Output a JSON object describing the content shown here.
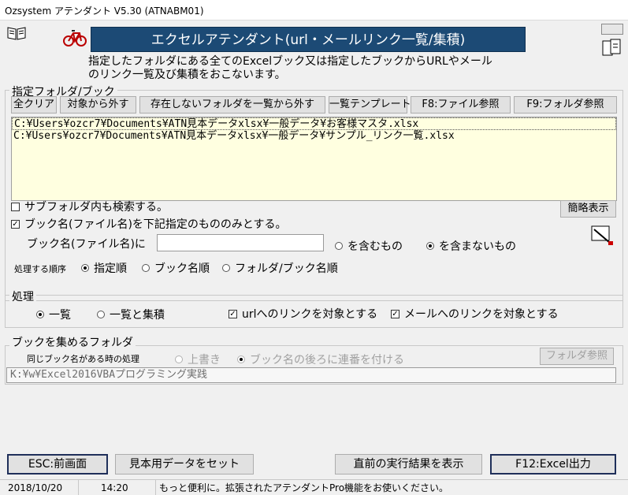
{
  "window": {
    "title": "Ozsystem アテンダント V5.30 (ATNABM01)"
  },
  "header": {
    "banner": "エクセルアテンダント(url・メールリンク一覧/集積)",
    "description_line1": "指定したフォルダにある全てのExcelブック又は指定したブックからURLやメール",
    "description_line2": "のリンク一覧及び集積をおこないます。"
  },
  "folder_group": {
    "label": "指定フォルダ/ブック",
    "buttons": {
      "clear_all": "全クリア",
      "exclude": "対象から外す",
      "remove_missing": "存在しないフォルダを一覧から外す",
      "list_template": "一覧テンプレート",
      "file_browse": "F8:ファイル参照",
      "folder_browse": "F9:フォルダ参照"
    },
    "paths": [
      "C:¥Users¥ozcr7¥Documents¥ATN見本データxlsx¥一般データ¥お客様マスタ.xlsx",
      "C:¥Users¥ozcr7¥Documents¥ATN見本データxlsx¥一般データ¥サンプル_リンク一覧.xlsx"
    ],
    "subfolder_check": {
      "label": "サブフォルダ内も検索する。",
      "checked": false
    },
    "bookname_check": {
      "label": "ブック名(ファイル名)を下記指定のもののみとする。",
      "checked": true
    },
    "bookname_label": "ブック名(ファイル名)に",
    "bookname_value": "",
    "contains": "を含むもの",
    "not_contains": "を含まないもの",
    "simple_view": "簡略表示",
    "order_label": "処理する順序",
    "order_options": [
      "指定順",
      "ブック名順",
      "フォルダ/ブック名順"
    ]
  },
  "process_group": {
    "label": "処理",
    "list_only": "一覧",
    "list_and_collect": "一覧と集積",
    "url_check": "urlへのリンクを対象とする",
    "mail_check": "メールへのリンクを対象とする"
  },
  "collect_group": {
    "label": "ブックを集めるフォルダ",
    "same_name_label": "同じブック名がある時の処理",
    "overwrite": "上書き",
    "append_number": "ブック名の後ろに連番を付ける",
    "folder_browse": "フォルダ参照",
    "folder_path": "K:¥w¥Excel2016VBAプログラミング実践"
  },
  "footer_buttons": {
    "esc": "ESC:前画面",
    "sample_data": "見本用データをセット",
    "show_last": "直前の実行結果を表示",
    "excel_output": "F12:Excel出力"
  },
  "status": {
    "date": "2018/10/20",
    "time": "14:20",
    "message": "もっと便利に。拡張されたアテンダントPro機能をお使いください。"
  }
}
